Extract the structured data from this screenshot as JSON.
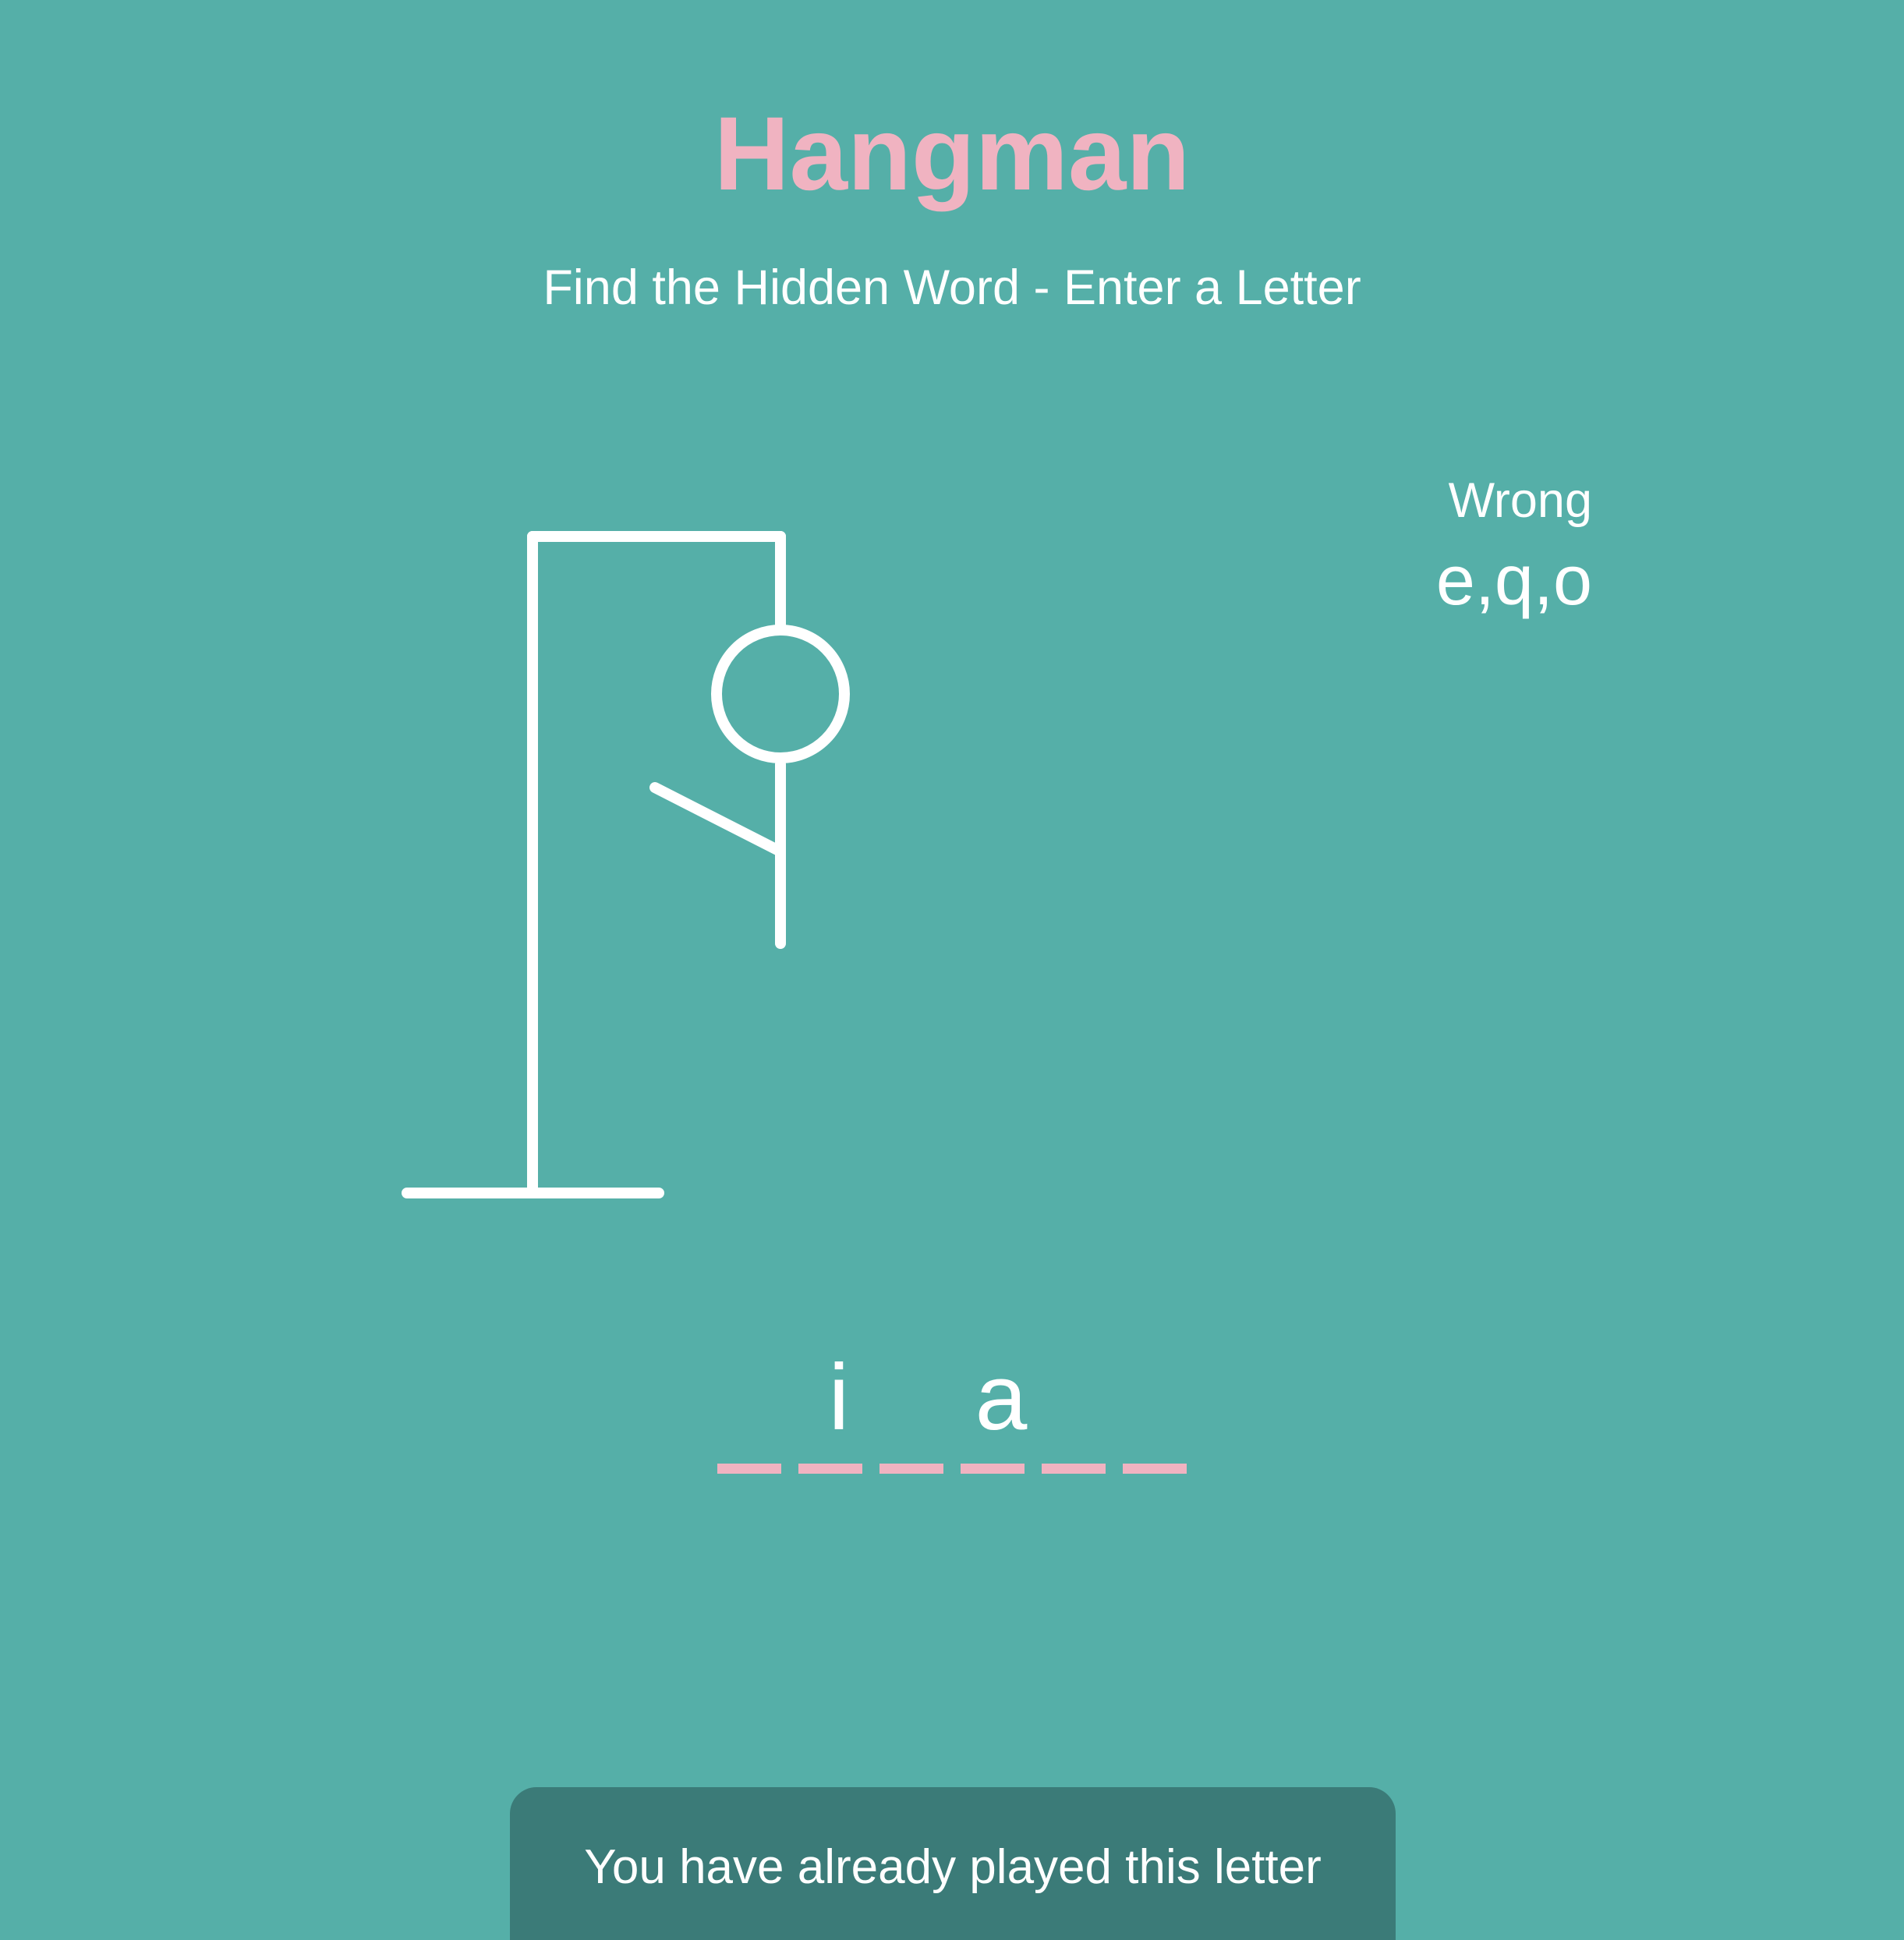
{
  "header": {
    "title": "Hangman",
    "subtitle": "Find the Hidden Word - Enter a Letter"
  },
  "wrong": {
    "label": "Wrong",
    "letters": "e,q,o"
  },
  "word": {
    "slots": [
      "",
      "i",
      "",
      "a",
      "",
      ""
    ]
  },
  "notification": {
    "message": "You have already played this letter"
  },
  "colors": {
    "background": "#55afa8",
    "accent": "#f0b3c1",
    "figure": "#ffffff",
    "toast": "#3b7b78"
  },
  "figure_parts": [
    "gallows",
    "head",
    "body",
    "left-arm"
  ]
}
